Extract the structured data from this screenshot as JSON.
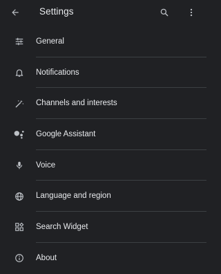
{
  "toolbar": {
    "title": "Settings"
  },
  "colors": {
    "background": "#202124",
    "text": "#e8eaed",
    "icon": "#bdc1c6",
    "divider": "#3c4043"
  },
  "icons": {
    "back": "arrow-back-icon",
    "search": "search-icon",
    "more": "more-vert-icon"
  },
  "settings": {
    "items": [
      {
        "label": "General",
        "icon": "tune-sliders-icon"
      },
      {
        "label": "Notifications",
        "icon": "bell-icon"
      },
      {
        "label": "Channels and interests",
        "icon": "magic-wand-icon"
      },
      {
        "label": "Google Assistant",
        "icon": "assistant-icon"
      },
      {
        "label": "Voice",
        "icon": "microphone-icon"
      },
      {
        "label": "Language and region",
        "icon": "globe-icon"
      },
      {
        "label": "Search Widget",
        "icon": "widgets-icon"
      },
      {
        "label": "About",
        "icon": "info-icon"
      }
    ]
  }
}
